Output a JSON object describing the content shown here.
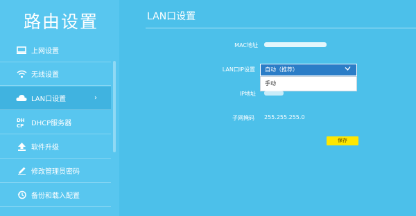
{
  "brand": "路由设置",
  "sidebar": {
    "items": [
      {
        "label": "上网设置",
        "icon": "monitor-icon"
      },
      {
        "label": "无线设置",
        "icon": "wifi-icon"
      },
      {
        "label": "LAN口设置",
        "icon": "cloud-icon",
        "active": true,
        "chevron": "›"
      },
      {
        "label": "DHCP服务器",
        "icon": "dhcp-icon"
      },
      {
        "label": "软件升级",
        "icon": "upload-arrow-icon"
      },
      {
        "label": "修改管理员密码",
        "icon": "pencil-icon"
      },
      {
        "label": "备份和载入配置",
        "icon": "history-icon"
      }
    ]
  },
  "main": {
    "title": "LAN口设置",
    "mac_label": "MAC地址",
    "lan_ip_label": "LAN口IP设置",
    "ip_label": "IP地址",
    "subnet_label": "子网掩码",
    "subnet_value": "255.255.255.0",
    "select": {
      "selected": "自动（推荐）",
      "options": [
        "手动"
      ]
    },
    "save_label": "保存"
  },
  "colors": {
    "background": "#4cc0ea",
    "sidebar": "#58c6ef",
    "select": "#2b7dc7",
    "save_button": "#ffe700"
  }
}
